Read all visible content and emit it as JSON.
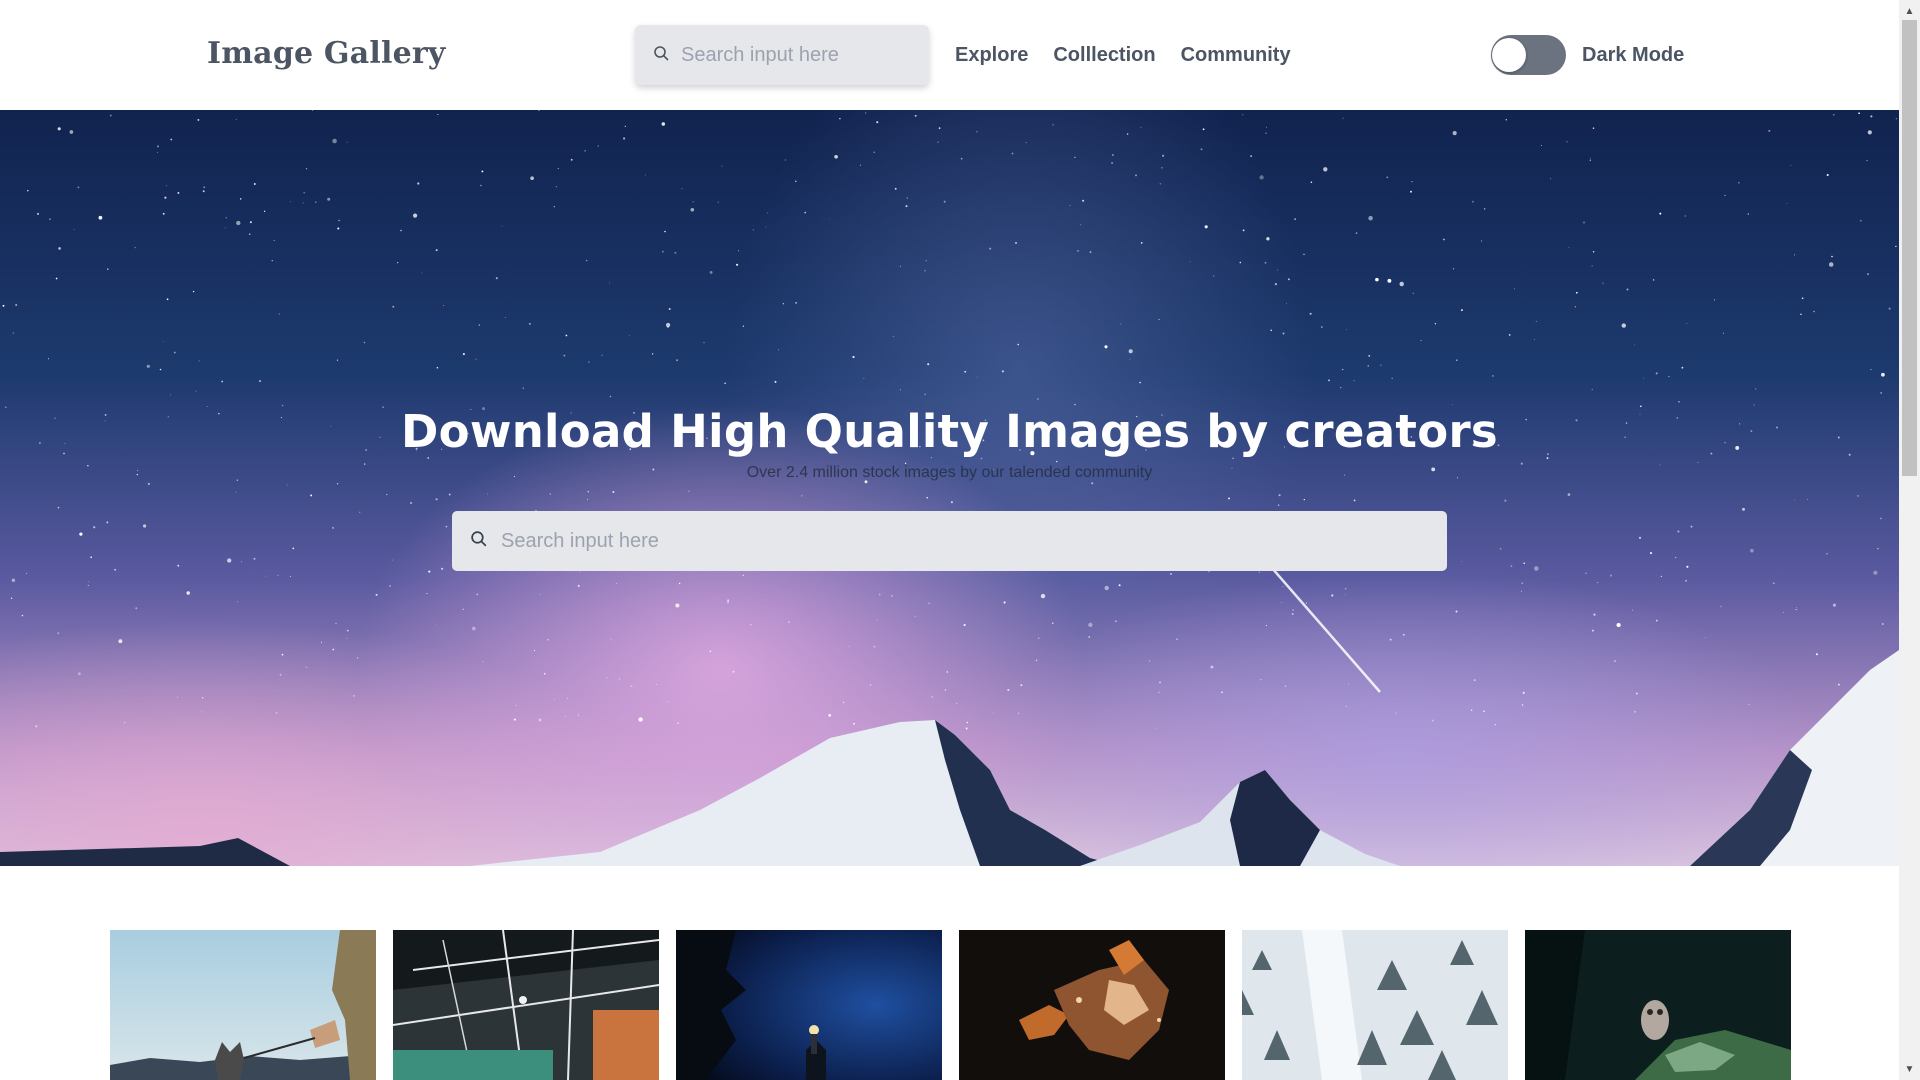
{
  "header": {
    "logo": "Image Gallery",
    "search_placeholder": "Search input here",
    "nav": [
      {
        "label": "Explore"
      },
      {
        "label": "Colllection"
      },
      {
        "label": "Community"
      }
    ],
    "dark_mode_label": "Dark Mode",
    "dark_mode_enabled": false
  },
  "hero": {
    "title": "Download High Quality Images by creators",
    "subtitle": "Over 2.4 million stock images by our talended community",
    "search_placeholder": "Search input here"
  },
  "gallery": {
    "thumbnails": [
      {
        "subject": "person-with-dog-on-leash"
      },
      {
        "subject": "industrial-ceiling"
      },
      {
        "subject": "night-sky-with-tree"
      },
      {
        "subject": "fox-dissolving"
      },
      {
        "subject": "snowy-forest-aerial"
      },
      {
        "subject": "owl-in-forest"
      }
    ]
  },
  "icons": {
    "search": "search-icon",
    "scroll_up": "chevron-up-icon",
    "scroll_down": "chevron-down-icon"
  },
  "colors": {
    "accent": "#4b5563",
    "search_bg": "#e5e7eb",
    "toggle_track": "#6b7280"
  }
}
